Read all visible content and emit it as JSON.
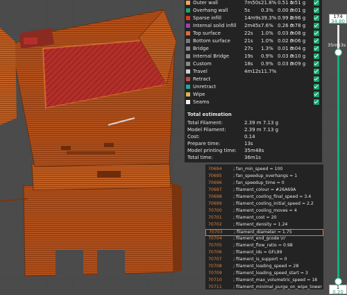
{
  "stats": {
    "rows": [
      {
        "name": "Outer wall",
        "time": "7m50s",
        "pct": "21.8%",
        "len": "0.51 m",
        "wt": "1.51 g",
        "color": "#f5a25d"
      },
      {
        "name": "Overhang wall",
        "time": "5s",
        "pct": "0.3%",
        "len": "0.00 m",
        "wt": "0.01 g",
        "color": "#1aa86e"
      },
      {
        "name": "Sparse infill",
        "time": "14m9s",
        "pct": "39.3%",
        "len": "0.99 m",
        "wt": "2.96 g",
        "color": "#d43c22"
      },
      {
        "name": "Internal solid infill",
        "time": "2m45s",
        "pct": "7.6%",
        "len": "0.26 m",
        "wt": "0.78 g",
        "color": "#9b45a8"
      },
      {
        "name": "Top surface",
        "time": "22s",
        "pct": "1.0%",
        "len": "0.03 m",
        "wt": "0.08 g",
        "color": "#e06b3c"
      },
      {
        "name": "Bottom surface",
        "time": "21s",
        "pct": "1.0%",
        "len": "0.02 m",
        "wt": "0.06 g",
        "color": "#7a7a7a"
      },
      {
        "name": "Bridge",
        "time": "27s",
        "pct": "1.3%",
        "len": "0.01 m",
        "wt": "0.04 g",
        "color": "#8a8a8a"
      },
      {
        "name": "Internal Bridge",
        "time": "19s",
        "pct": "0.9%",
        "len": "0.03 m",
        "wt": "0.10 g",
        "color": "#8a8a8a"
      },
      {
        "name": "Custom",
        "time": "18s",
        "pct": "0.9%",
        "len": "0.03 m",
        "wt": "0.09 g",
        "color": "#8a8a8a"
      },
      {
        "name": "Travel",
        "time": "4m12s",
        "pct": "11.7%",
        "len": "",
        "wt": "",
        "color": "#d0d0d0"
      },
      {
        "name": "Retract",
        "time": "",
        "pct": "",
        "len": "",
        "wt": "",
        "color": "#c04a4a"
      },
      {
        "name": "Unretract",
        "time": "",
        "pct": "",
        "len": "",
        "wt": "",
        "color": "#24a89a"
      },
      {
        "name": "Wipe",
        "time": "",
        "pct": "",
        "len": "",
        "wt": "",
        "color": "#d8b84a"
      },
      {
        "name": "Seams",
        "time": "",
        "pct": "",
        "len": "",
        "wt": "",
        "color": "#f0f0f0"
      }
    ],
    "estimation": {
      "title": "Total estimation",
      "rows": [
        {
          "label": "Total Filament:",
          "value": "2.39 m    7.13 g"
        },
        {
          "label": "Model Filament:",
          "value": "2.39 m    7.13 g"
        },
        {
          "label": "Cost:",
          "value": "0.14"
        },
        {
          "label": "Prepare time:",
          "value": "13s"
        },
        {
          "label": "Model printing time:",
          "value": "35m48s"
        },
        {
          "label": "Total time:",
          "value": "36m1s"
        }
      ]
    }
  },
  "gcode": {
    "lines": [
      {
        "n": "70694",
        "t": "; fan_min_speed = 100"
      },
      {
        "n": "70695",
        "t": "; fan_speedup_overhangs = 1"
      },
      {
        "n": "70696",
        "t": "; fan_speedup_time = 0"
      },
      {
        "n": "70697",
        "t": "; filament_colour = #26A69A"
      },
      {
        "n": "70698",
        "t": "; filament_cooling_final_speed = 3.4"
      },
      {
        "n": "70699",
        "t": "; filament_cooling_initial_speed = 2.2"
      },
      {
        "n": "70700",
        "t": "; filament_cooling_moves = 4"
      },
      {
        "n": "70701",
        "t": "; filament_cost = 20"
      },
      {
        "n": "70702",
        "t": "; filament_density = 1.24"
      },
      {
        "n": "70703",
        "t": "; filament_diameter = 1.75"
      },
      {
        "n": "70704",
        "t": "; filament_end_gcode \\n'"
      },
      {
        "n": "70705",
        "t": "; filament_flow_ratio = 0.98"
      },
      {
        "n": "70706",
        "t": "; filament_ids = GFL99"
      },
      {
        "n": "70707",
        "t": "; filament_is_support = 0"
      },
      {
        "n": "70708",
        "t": "; filament_loading_speed = 28"
      },
      {
        "n": "70709",
        "t": "; filament_loading_speed_start = 3"
      },
      {
        "n": "70710",
        "t": "; filament_max_volumetric_speed = 18"
      },
      {
        "n": "70711",
        "t": "; filament_minimal_purge_on_wipe_tower = 15"
      }
    ]
  },
  "slider": {
    "top_value_line1": "174",
    "top_value_line2": "34.80",
    "bottom_value_line1": "1",
    "bottom_value_line2": "0.20",
    "time_label": "35m53s"
  }
}
